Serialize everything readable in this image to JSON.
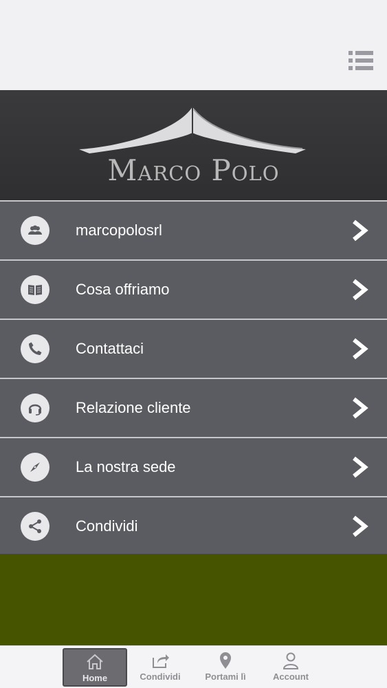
{
  "brand": {
    "name": "Marco Polo"
  },
  "menu": [
    {
      "label": "marcopolosrl",
      "icon": "group-icon"
    },
    {
      "label": "Cosa offriamo",
      "icon": "book-icon"
    },
    {
      "label": "Contattaci",
      "icon": "phone-icon"
    },
    {
      "label": "Relazione cliente",
      "icon": "headset-icon"
    },
    {
      "label": "La nostra sede",
      "icon": "compass-icon"
    },
    {
      "label": "Condividi",
      "icon": "share-icon"
    }
  ],
  "tabs": [
    {
      "label": "Home",
      "icon": "home-icon",
      "active": true
    },
    {
      "label": "Condividi",
      "icon": "share-out-icon",
      "active": false
    },
    {
      "label": "Portami lì",
      "icon": "location-pin-icon",
      "active": false
    },
    {
      "label": "Account",
      "icon": "user-icon",
      "active": false
    }
  ],
  "colors": {
    "accent": "#465400",
    "row": "#5b5c61",
    "hero": "#3a3a3c"
  }
}
